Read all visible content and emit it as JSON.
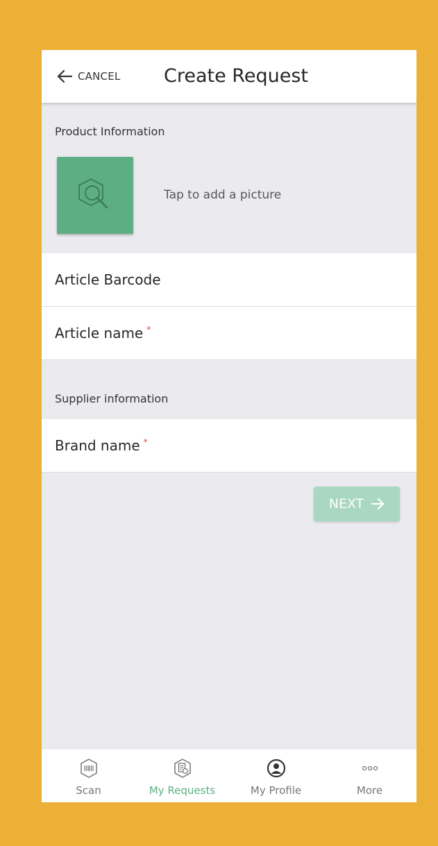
{
  "header": {
    "cancel_label": "CANCEL",
    "title": "Create Request",
    "back_icon": "arrow-left-icon"
  },
  "product_section": {
    "label": "Product Information",
    "photo_hint": "Tap to add a picture",
    "photo_icon": "search-icon"
  },
  "fields": [
    {
      "label": "Article Barcode",
      "required": false
    },
    {
      "label": "Article name",
      "required": true,
      "marker": "*"
    },
    {
      "label": "Brand name",
      "required": true,
      "marker": "*"
    }
  ],
  "supplier_section": {
    "label": "Supplier information"
  },
  "next_button": {
    "label": "NEXT",
    "icon": "arrow-right-icon"
  },
  "tabbar": {
    "active_index": 1,
    "tabs": [
      {
        "label": "Scan",
        "icon": "scan-icon"
      },
      {
        "label": "My Requests",
        "icon": "requests-icon"
      },
      {
        "label": "My Profile",
        "icon": "profile-icon"
      },
      {
        "label": "More",
        "icon": "more-icon"
      }
    ]
  },
  "colors": {
    "accent": "#5daf83",
    "accent_disabled": "#a9d7c0",
    "frame_bg": "#ebb035",
    "required": "#e0463c"
  }
}
